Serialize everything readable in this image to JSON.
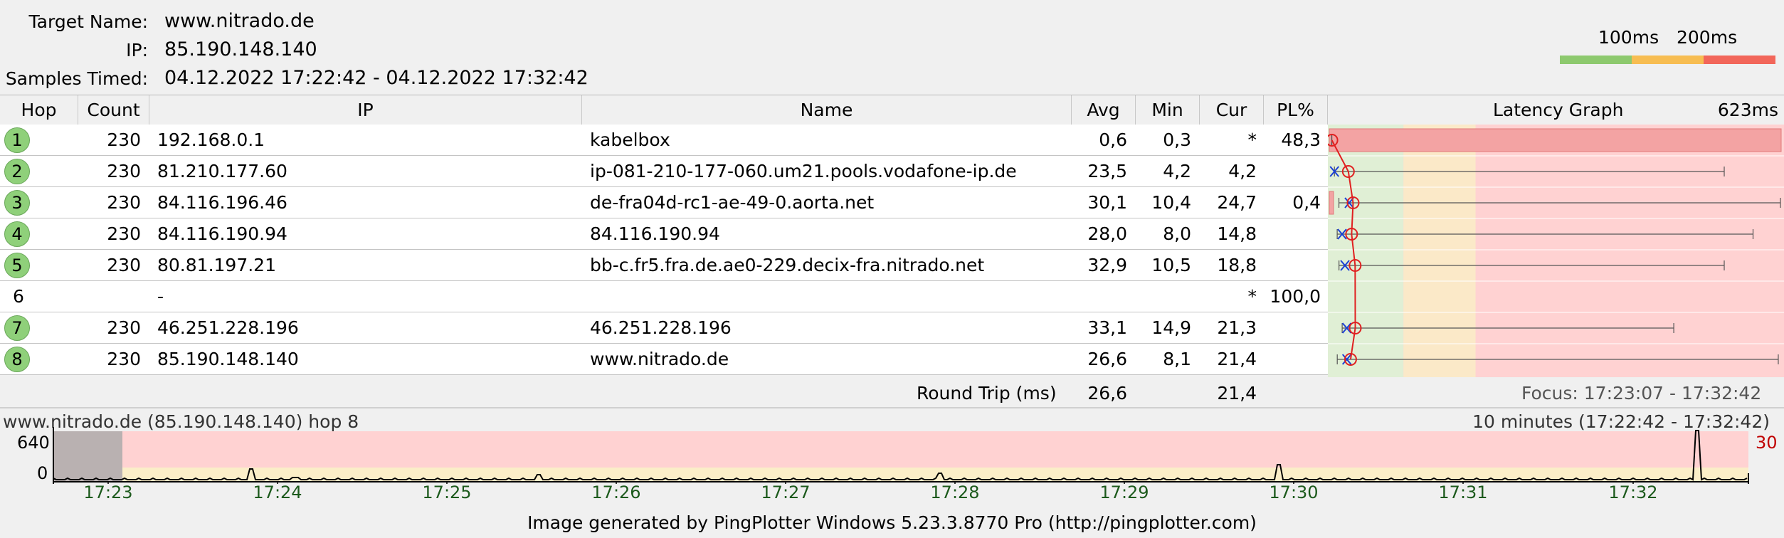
{
  "header": {
    "target_name_label": "Target Name:",
    "target_name": "www.nitrado.de",
    "ip_label": "IP:",
    "ip": "85.190.148.140",
    "samples_label": "Samples Timed:",
    "samples": "04.12.2022 17:22:42 - 04.12.2022 17:32:42",
    "scale_100": "100ms",
    "scale_200": "200ms"
  },
  "table": {
    "columns": [
      "Hop",
      "Count",
      "IP",
      "Name",
      "Avg",
      "Min",
      "Cur",
      "PL%",
      "Latency Graph",
      "623ms"
    ],
    "rows": [
      {
        "hop": "1",
        "count": "230",
        "ip": "192.168.0.1",
        "name": "kabelbox",
        "avg": "0,6",
        "min": "0,3",
        "cur": "*",
        "pl": "48,3",
        "badge": true
      },
      {
        "hop": "2",
        "count": "230",
        "ip": "81.210.177.60",
        "name": "ip-081-210-177-060.um21.pools.vodafone-ip.de",
        "avg": "23,5",
        "min": "4,2",
        "cur": "4,2",
        "pl": "",
        "badge": true
      },
      {
        "hop": "3",
        "count": "230",
        "ip": "84.116.196.46",
        "name": "de-fra04d-rc1-ae-49-0.aorta.net",
        "avg": "30,1",
        "min": "10,4",
        "cur": "24,7",
        "pl": "0,4",
        "badge": true
      },
      {
        "hop": "4",
        "count": "230",
        "ip": "84.116.190.94",
        "name": "84.116.190.94",
        "avg": "28,0",
        "min": "8,0",
        "cur": "14,8",
        "pl": "",
        "badge": true
      },
      {
        "hop": "5",
        "count": "230",
        "ip": "80.81.197.21",
        "name": "bb-c.fr5.fra.de.ae0-229.decix-fra.nitrado.net",
        "avg": "32,9",
        "min": "10,5",
        "cur": "18,8",
        "pl": "",
        "badge": true
      },
      {
        "hop": "6",
        "count": "",
        "ip": "-",
        "name": "",
        "avg": "",
        "min": "",
        "cur": "*",
        "pl": "100,0",
        "badge": false
      },
      {
        "hop": "7",
        "count": "230",
        "ip": "46.251.228.196",
        "name": "46.251.228.196",
        "avg": "33,1",
        "min": "14,9",
        "cur": "21,3",
        "pl": "",
        "badge": true
      },
      {
        "hop": "8",
        "count": "230",
        "ip": "85.190.148.140",
        "name": "www.nitrado.de",
        "avg": "26,6",
        "min": "8,1",
        "cur": "21,4",
        "pl": "",
        "badge": true
      }
    ],
    "round_trip_label": "Round Trip (ms)",
    "round_trip_avg": "26,6",
    "round_trip_cur": "21,4",
    "focus": "Focus: 17:23:07 - 17:32:42"
  },
  "latency": {
    "max_ms": 623,
    "hops": [
      {
        "min": 0.3,
        "avg": 0.6,
        "max": 0.6,
        "cur": null,
        "pl": 48.3
      },
      {
        "min": 4.2,
        "avg": 23.5,
        "max": 545,
        "cur": 4.2,
        "pl": 0
      },
      {
        "min": 10.4,
        "avg": 30.1,
        "max": 623,
        "cur": 24.7,
        "pl": 0.4
      },
      {
        "min": 8.0,
        "avg": 28.0,
        "max": 585,
        "cur": 14.8,
        "pl": 0
      },
      {
        "min": 10.5,
        "avg": 32.9,
        "max": 545,
        "cur": 18.8,
        "pl": 0
      },
      null,
      {
        "min": 14.9,
        "avg": 33.1,
        "max": 475,
        "cur": 21.3,
        "pl": 0
      },
      {
        "min": 8.1,
        "avg": 26.6,
        "max": 620,
        "cur": 21.4,
        "pl": 0
      }
    ]
  },
  "timeline": {
    "title": "www.nitrado.de (85.190.148.140) hop 8",
    "range": "10 minutes (17:22:42 - 17:32:42)",
    "y_top": "640",
    "y_bottom": "0",
    "right_value": "30",
    "ticks": [
      "17:23",
      "17:24",
      "17:25",
      "17:26",
      "17:27",
      "17:28",
      "17:29",
      "17:30",
      "17:31",
      "17:32"
    ]
  },
  "footer": "Image generated by PingPlotter Windows 5.23.3.8770 Pro (http://pingplotter.com)",
  "colors": {
    "good": "#8dc96e",
    "warn": "#f7bd52",
    "bad": "#f2665a",
    "badge": "#8fd07a"
  }
}
